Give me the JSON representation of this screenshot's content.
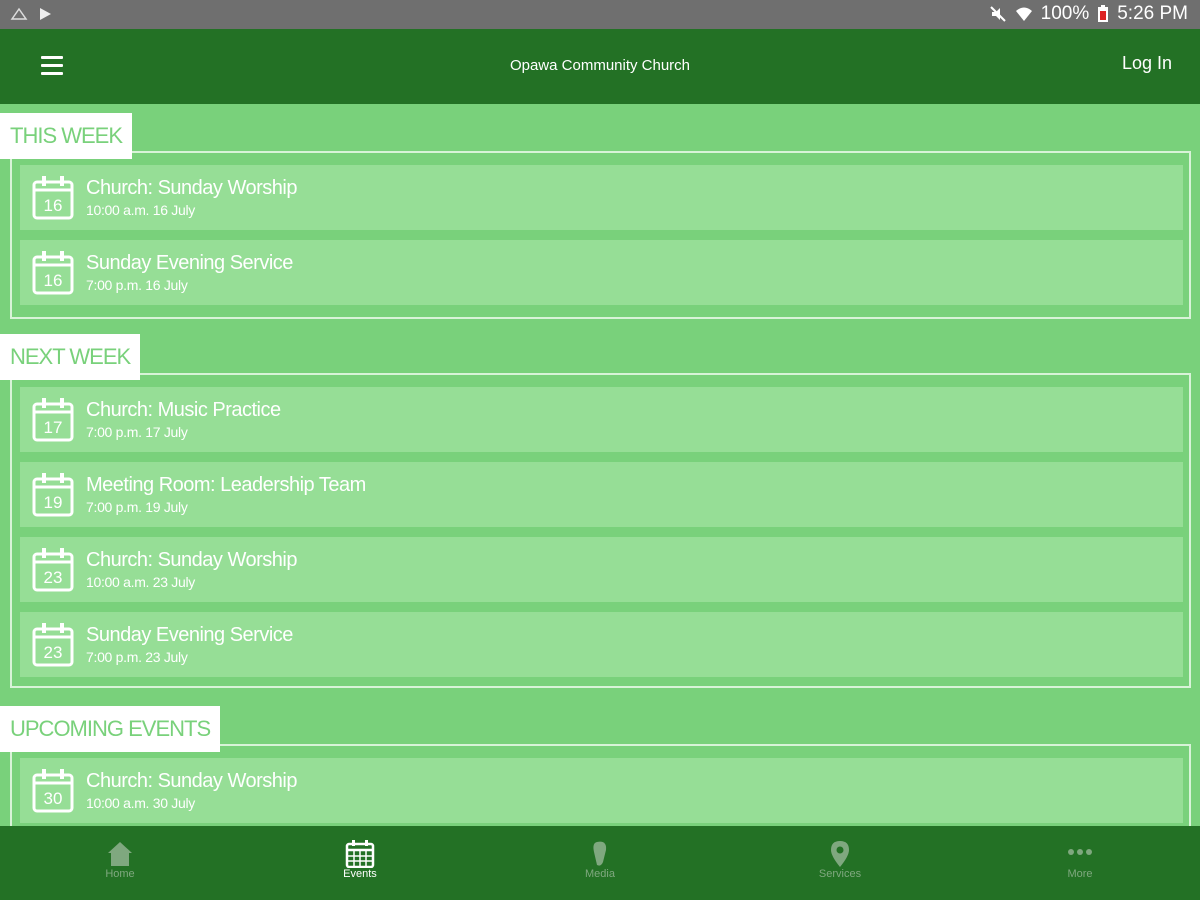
{
  "status_bar": {
    "battery": "100%",
    "time": "5:26 PM"
  },
  "header": {
    "title": "Opawa Community Church",
    "login_label": "Log In"
  },
  "sections": [
    {
      "label": "THIS WEEK",
      "events": [
        {
          "day": "16",
          "title": "Church: Sunday Worship",
          "time": "10:00 a.m. 16 July"
        },
        {
          "day": "16",
          "title": "Sunday Evening Service",
          "time": "7:00 p.m. 16 July"
        }
      ]
    },
    {
      "label": "NEXT WEEK",
      "events": [
        {
          "day": "17",
          "title": "Church: Music Practice",
          "time": "7:00 p.m. 17 July"
        },
        {
          "day": "19",
          "title": "Meeting Room: Leadership Team",
          "time": "7:00 p.m. 19 July"
        },
        {
          "day": "23",
          "title": "Church: Sunday Worship",
          "time": "10:00 a.m. 23 July"
        },
        {
          "day": "23",
          "title": "Sunday Evening Service",
          "time": "7:00 p.m. 23 July"
        }
      ]
    },
    {
      "label": "UPCOMING EVENTS",
      "events": [
        {
          "day": "30",
          "title": "Church: Sunday Worship",
          "time": "10:00 a.m. 30 July"
        }
      ]
    }
  ],
  "bottom_nav": {
    "active": "Events",
    "items": [
      {
        "label": "Home",
        "icon": "home-icon"
      },
      {
        "label": "Events",
        "icon": "calendar-icon"
      },
      {
        "label": "Media",
        "icon": "microphone-icon"
      },
      {
        "label": "Services",
        "icon": "location-pin-icon"
      },
      {
        "label": "More",
        "icon": "more-dots-icon"
      }
    ]
  },
  "colors": {
    "header": "#237125",
    "background": "#79d17b",
    "row": "#96de96",
    "status_bar": "#6f6f6f"
  }
}
